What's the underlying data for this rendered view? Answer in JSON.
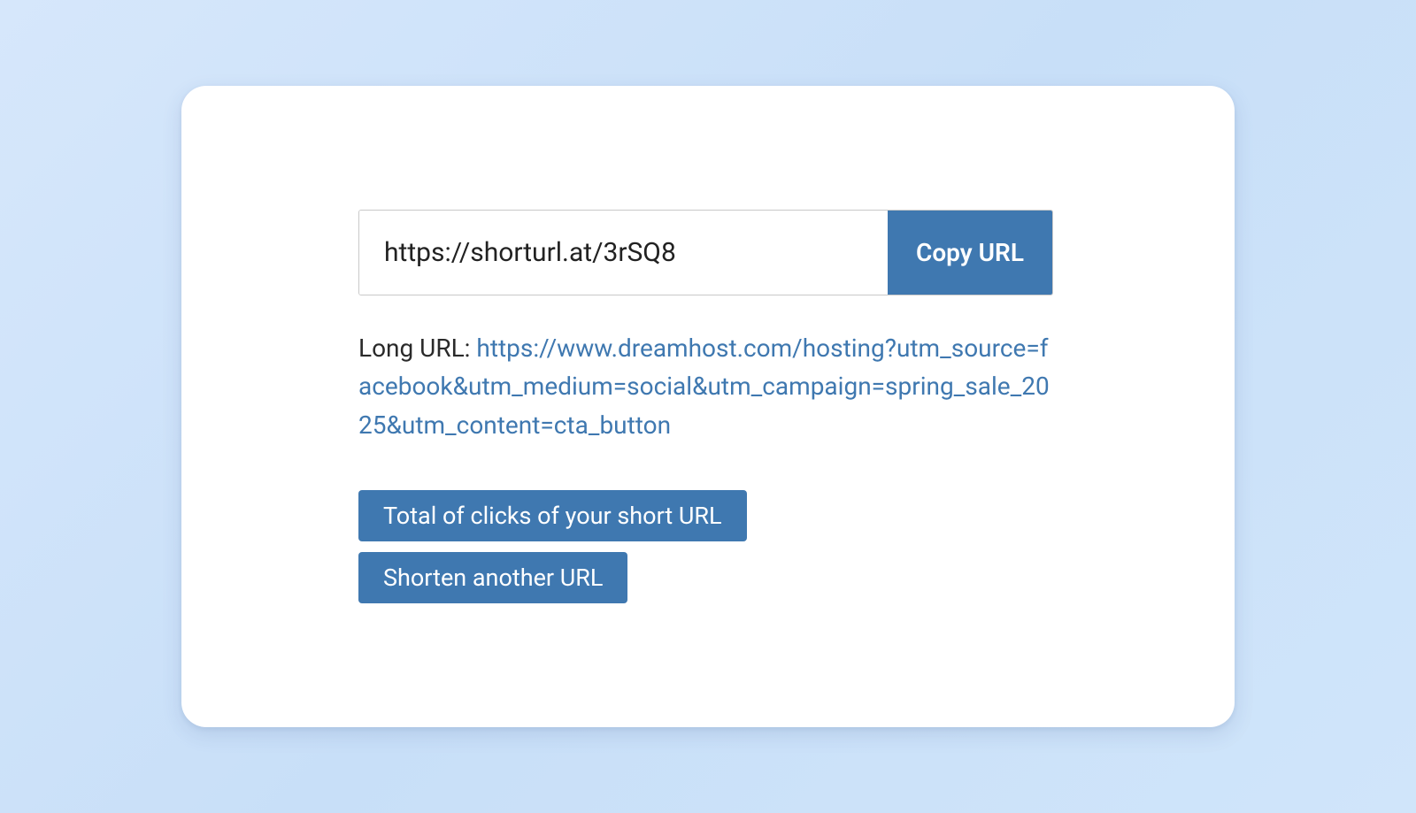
{
  "shortUrl": {
    "value": "https://shorturl.at/3rSQ8",
    "copyLabel": "Copy URL"
  },
  "longUrl": {
    "prefix": "Long URL: ",
    "value": "https://www.dreamhost.com/hosting?utm_source=facebook&utm_medium=social&utm_campaign=spring_sale_2025&utm_content=cta_button"
  },
  "buttons": {
    "totalClicks": "Total of clicks of your short URL",
    "shortenAnother": "Shorten another URL"
  },
  "colors": {
    "accent": "#3f78b0",
    "backgroundGradientStart": "#d6e7fb",
    "backgroundGradientEnd": "#d0e5fa",
    "cardBackground": "#ffffff"
  }
}
